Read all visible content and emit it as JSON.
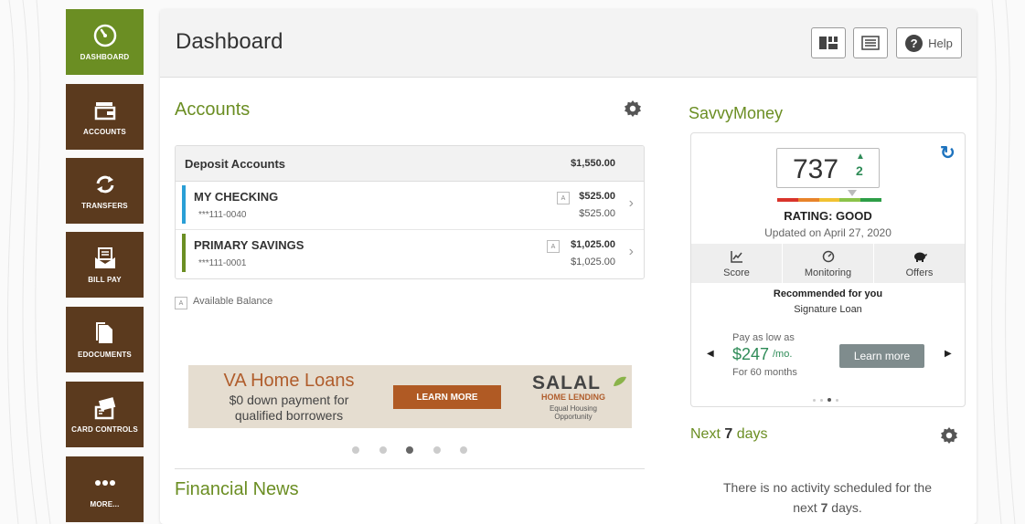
{
  "sidebar": {
    "items": [
      {
        "label": "DASHBOARD",
        "icon": "speedometer-icon",
        "active": true
      },
      {
        "label": "ACCOUNTS",
        "icon": "wallet-icon"
      },
      {
        "label": "TRANSFERS",
        "icon": "transfer-arrows-icon"
      },
      {
        "label": "BILL PAY",
        "icon": "bill-envelope-icon"
      },
      {
        "label": "EDOCUMENTS",
        "icon": "document-icon"
      },
      {
        "label": "CARD CONTROLS",
        "icon": "card-hand-icon"
      },
      {
        "label": "MORE...",
        "icon": "more-dots-icon"
      }
    ]
  },
  "header": {
    "title": "Dashboard",
    "help_label": "Help"
  },
  "accounts": {
    "title": "Accounts",
    "group_title": "Deposit Accounts",
    "group_total": "$1,550.00",
    "rows": [
      {
        "name": "MY CHECKING",
        "number": "***111-0040",
        "available": "$525.00",
        "current": "$525.00",
        "color": "#2a9fd6"
      },
      {
        "name": "PRIMARY SAVINGS",
        "number": "***111-0001",
        "available": "$1,025.00",
        "current": "$1,025.00",
        "color": "#6b8e23"
      }
    ],
    "badge": "A",
    "available_label": "Available Balance"
  },
  "banner": {
    "headline": "VA Home Loans",
    "line1": "$0 down payment for",
    "line2": "qualified borrowers",
    "button": "LEARN MORE",
    "logo": "SALAL",
    "logo_sub": "HOME LENDING",
    "logo_sub2a": "Equal Housing",
    "logo_sub2b": "Opportunity",
    "slide_count": 5,
    "active_slide": 3
  },
  "financial_news": {
    "title": "Financial News"
  },
  "savvy": {
    "title": "SavvyMoney",
    "score": "737",
    "change": "2",
    "rating": "RATING: GOOD",
    "updated": "Updated on April 27, 2020",
    "tabs": [
      {
        "label": "Score",
        "icon": "chart-icon"
      },
      {
        "label": "Monitoring",
        "icon": "monitoring-icon"
      },
      {
        "label": "Offers",
        "icon": "piggy-bank-icon"
      }
    ],
    "rec_title": "Recommended for you",
    "rec_product": "Signature Loan",
    "pay_line1": "Pay as low as",
    "pay_amount": "$247",
    "pay_unit": "/mo.",
    "pay_term": "For 60 months",
    "learn_more": "Learn more",
    "slide_count": 4,
    "active_slide": 3
  },
  "next_days": {
    "title_pre": "Next",
    "title_num": "7",
    "title_post": "days",
    "msg_line1": "There is no activity scheduled for the",
    "msg_pre": "next",
    "msg_num": "7",
    "msg_post": "days."
  },
  "colors": {
    "nav_brown": "#5b3a1e",
    "nav_active": "#6b8e23",
    "accent_green": "#6b8e23",
    "money_green": "#2e8b57",
    "refresh_blue": "#1e73be"
  }
}
